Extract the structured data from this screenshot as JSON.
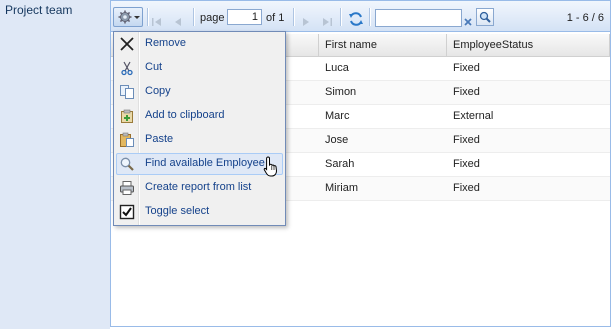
{
  "section": {
    "label": "Project team"
  },
  "toolbar": {
    "page_label": "page",
    "page_value": "1",
    "of_label": "of 1",
    "search_value": "",
    "count_label": "1 - 6 / 6"
  },
  "grid": {
    "columns": [
      "",
      "First name",
      "EmployeeStatus"
    ],
    "rows": [
      {
        "first_name": "Luca",
        "status": "Fixed"
      },
      {
        "first_name": "Simon",
        "status": "Fixed"
      },
      {
        "first_name": "Marc",
        "status": "External"
      },
      {
        "first_name": "Jose",
        "status": "Fixed"
      },
      {
        "first_name": "Sarah",
        "status": "Fixed"
      },
      {
        "first_name": "Miriam",
        "status": "Fixed"
      }
    ]
  },
  "menu": {
    "items": [
      {
        "label": "Remove",
        "icon": "remove-icon"
      },
      {
        "label": "Cut",
        "icon": "scissors-icon"
      },
      {
        "label": "Copy",
        "icon": "copy-icon"
      },
      {
        "label": "Add to clipboard",
        "icon": "add-to-clipboard-icon"
      },
      {
        "label": "Paste",
        "icon": "paste-icon"
      },
      {
        "label": "Find available Employee",
        "icon": "magnifier-icon",
        "active": true
      },
      {
        "label": "Create report from list",
        "icon": "printer-icon"
      },
      {
        "label": "Toggle select",
        "icon": "checkbox-icon"
      }
    ]
  },
  "colors": {
    "panel_bg": "#dfe8f6",
    "border": "#99bbe8",
    "menu_text": "#15428b",
    "active_item_bg": "#dfe8f6"
  }
}
